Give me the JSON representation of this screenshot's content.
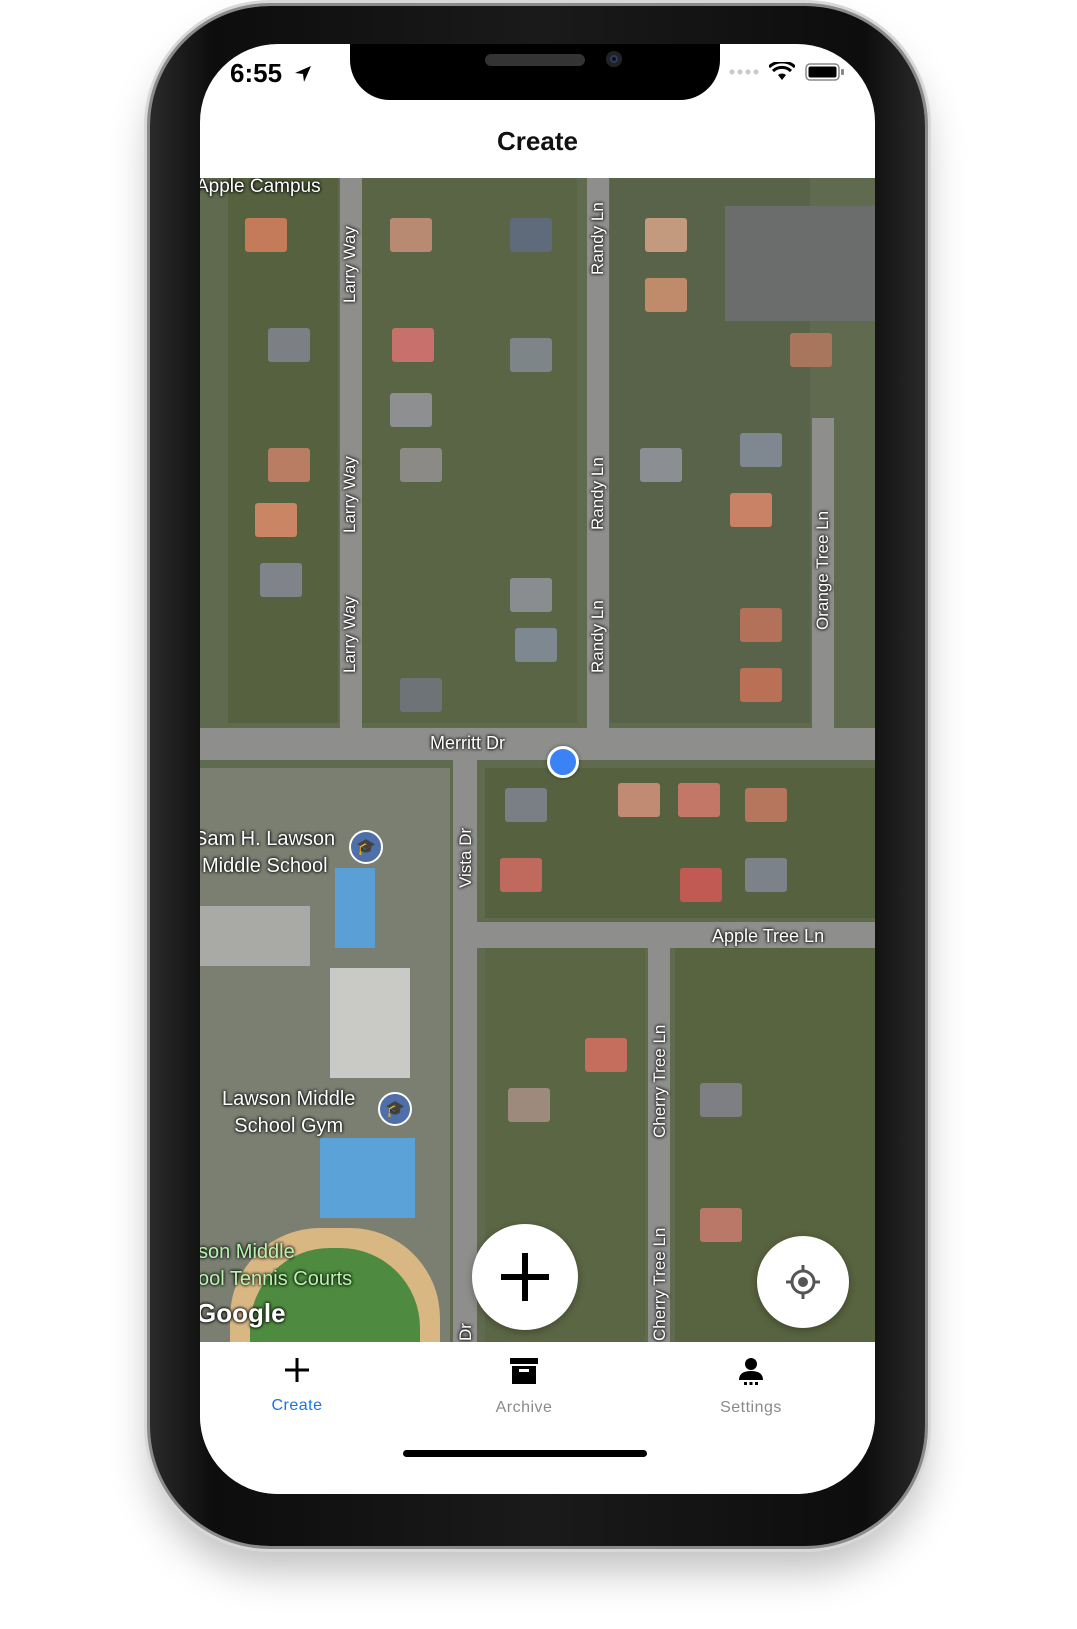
{
  "status_bar": {
    "time": "6:55"
  },
  "nav": {
    "title": "Create"
  },
  "map": {
    "street_labels": {
      "larry_way": "Larry Way",
      "randy_ln": "Randy Ln",
      "orange_tree_ln": "Orange Tree Ln",
      "merritt_dr": "Merritt Dr",
      "vista_dr": "Vista Dr",
      "vista_dr_partial": "Dr",
      "apple_tree_ln": "Apple Tree Ln",
      "cherry_tree_ln": "Cherry Tree Ln"
    },
    "places": {
      "apple_campus": "Apple Campus",
      "lawson_school_line1": "Sam H. Lawson",
      "lawson_school_line2": "Middle School",
      "gym_line1": "Lawson Middle",
      "gym_line2": "School Gym",
      "tennis_line1": "son Middle",
      "tennis_line2": "ool Tennis Courts"
    },
    "attribution": "Google"
  },
  "tabs": [
    {
      "label": "Create",
      "icon": "plus-icon",
      "active": true
    },
    {
      "label": "Archive",
      "icon": "archive-box-icon",
      "active": false
    },
    {
      "label": "Settings",
      "icon": "person-icon",
      "active": false
    }
  ],
  "colors": {
    "accent": "#1a73e8",
    "inactive": "#8a8a8a"
  }
}
